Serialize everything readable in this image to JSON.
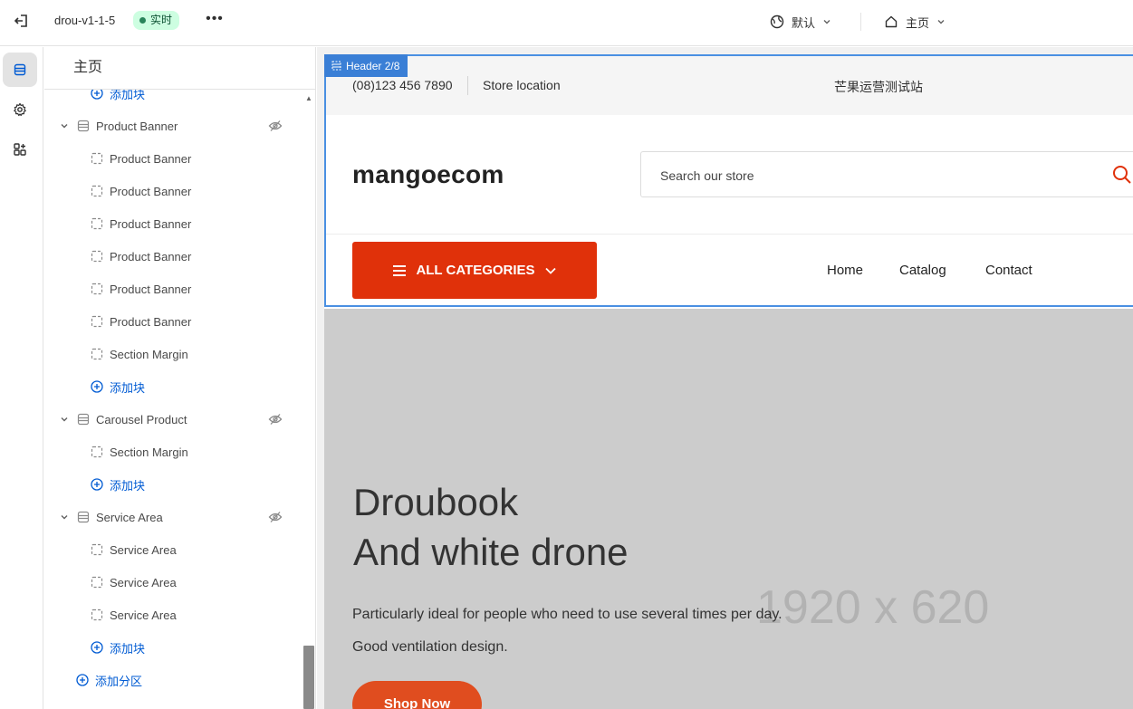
{
  "topbar": {
    "theme_name": "drou-v1-1-5",
    "status_badge": "实时",
    "more": "•••",
    "theme_selector": "默认",
    "page_selector": "主页"
  },
  "sidebar": {
    "title": "主页",
    "items": [
      {
        "kind": "add",
        "label": "添加块"
      },
      {
        "kind": "section",
        "label": "Product Banner"
      },
      {
        "kind": "block",
        "label": "Product Banner"
      },
      {
        "kind": "block",
        "label": "Product Banner"
      },
      {
        "kind": "block",
        "label": "Product Banner"
      },
      {
        "kind": "block",
        "label": "Product Banner"
      },
      {
        "kind": "block",
        "label": "Product Banner"
      },
      {
        "kind": "block",
        "label": "Product Banner"
      },
      {
        "kind": "block",
        "label": "Section Margin"
      },
      {
        "kind": "add",
        "label": "添加块"
      },
      {
        "kind": "section",
        "label": "Carousel Product"
      },
      {
        "kind": "block",
        "label": "Section Margin"
      },
      {
        "kind": "add",
        "label": "添加块"
      },
      {
        "kind": "section",
        "label": "Service Area"
      },
      {
        "kind": "block",
        "label": "Service Area"
      },
      {
        "kind": "block",
        "label": "Service Area"
      },
      {
        "kind": "block",
        "label": "Service Area"
      },
      {
        "kind": "add",
        "label": "添加块"
      },
      {
        "kind": "addsection",
        "label": "添加分区"
      }
    ]
  },
  "preview": {
    "selection_tag": "Header 2/8",
    "phone": "(08)123 456 7890",
    "store_location": "Store location",
    "site_name": "芒果运营测试站",
    "logo": "mangoecom",
    "search_placeholder": "Search our store",
    "all_categories": "ALL CATEGORIES",
    "nav": [
      "Home",
      "Catalog",
      "Contact"
    ],
    "hero": {
      "line1": "Droubook",
      "line2": "And white drone",
      "dimensions": "1920 x 620",
      "description": "Particularly ideal for people who need to use several times per day. Good ventilation design.",
      "button": "Shop Now"
    }
  },
  "colors": {
    "accent": "#e0310a",
    "selection": "#4a90e2",
    "link": "#005bd3",
    "badge_bg": "#cdfee1"
  }
}
